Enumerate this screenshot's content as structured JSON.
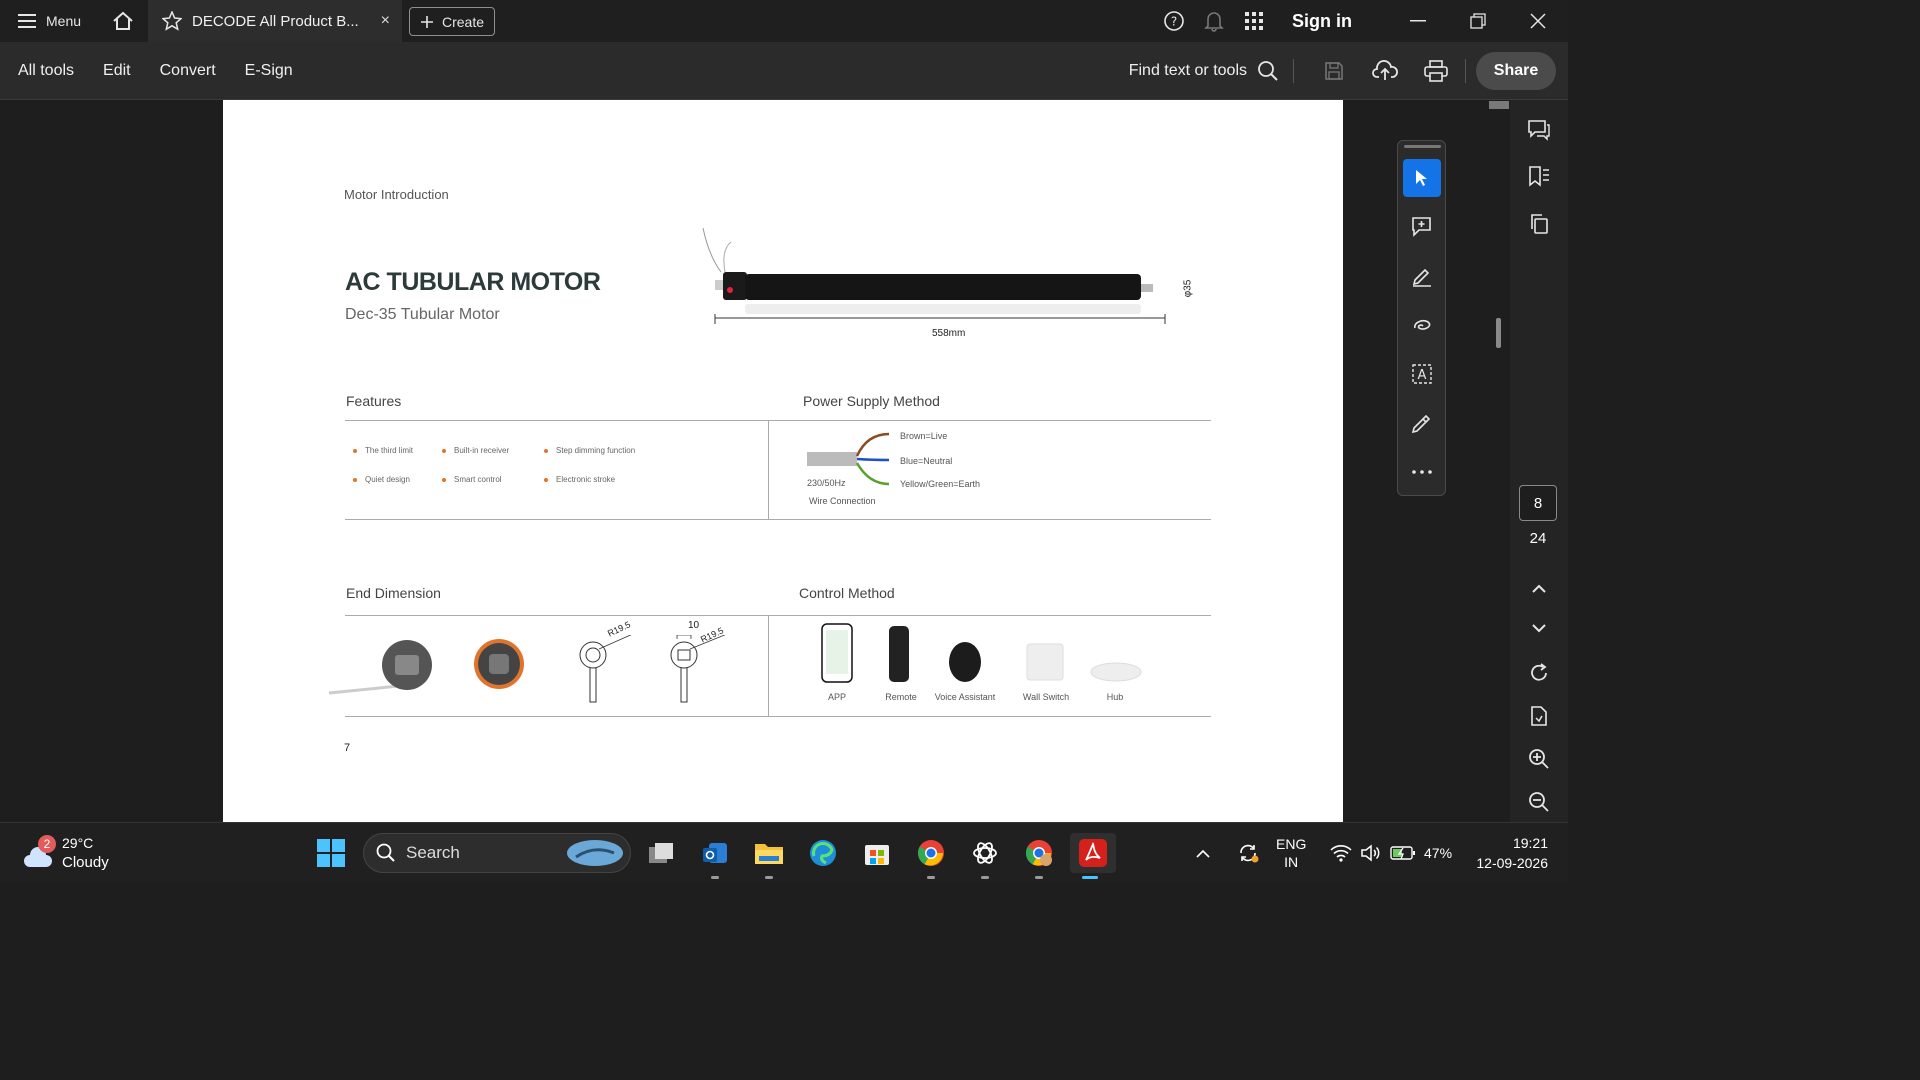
{
  "titlebar": {
    "menu_label": "Menu",
    "tab_title": "DECODE All Product B...",
    "tab_close": "×",
    "create_label": "Create",
    "signin_label": "Sign in"
  },
  "toolbar": {
    "items": [
      "All tools",
      "Edit",
      "Convert",
      "E-Sign"
    ],
    "find_label": "Find text or tools",
    "share_label": "Share"
  },
  "page": {
    "section_heading": "Motor Introduction",
    "product_title": "AC TUBULAR MOTOR",
    "product_subtitle": "Dec-35 Tubular Motor",
    "length_label": "558mm",
    "diameter_label": "φ35",
    "features_heading": "Features",
    "features": [
      "The third limit",
      "Built-in receiver",
      "Step dimming function",
      "Quiet design",
      "Smart control",
      "Electronic stroke"
    ],
    "power_heading": "Power Supply Method",
    "wires": [
      "Brown=Live",
      "Blue=Neutral",
      "Yellow/Green=Earth"
    ],
    "power_spec": "230/50Hz",
    "wire_caption": "Wire Connection",
    "end_heading": "End Dimension",
    "end_labels": [
      "R19.5",
      "10",
      "R19.5"
    ],
    "control_heading": "Control Method",
    "controls": [
      "APP",
      "Remote",
      "Voice Assistant",
      "Wall Switch",
      "Hub"
    ],
    "page_number": "7"
  },
  "navigation": {
    "current_page": "8",
    "total_pages": "24"
  },
  "taskbar": {
    "weather_badge": "2",
    "temperature": "29°C",
    "condition": "Cloudy",
    "search_label": "Search",
    "lang_top": "ENG",
    "lang_bottom": "IN",
    "battery": "47%",
    "time": "19:21",
    "date": "12-09-2026"
  },
  "colors": {
    "accent": "#1473e6",
    "feature_dot": "#e0742c"
  }
}
